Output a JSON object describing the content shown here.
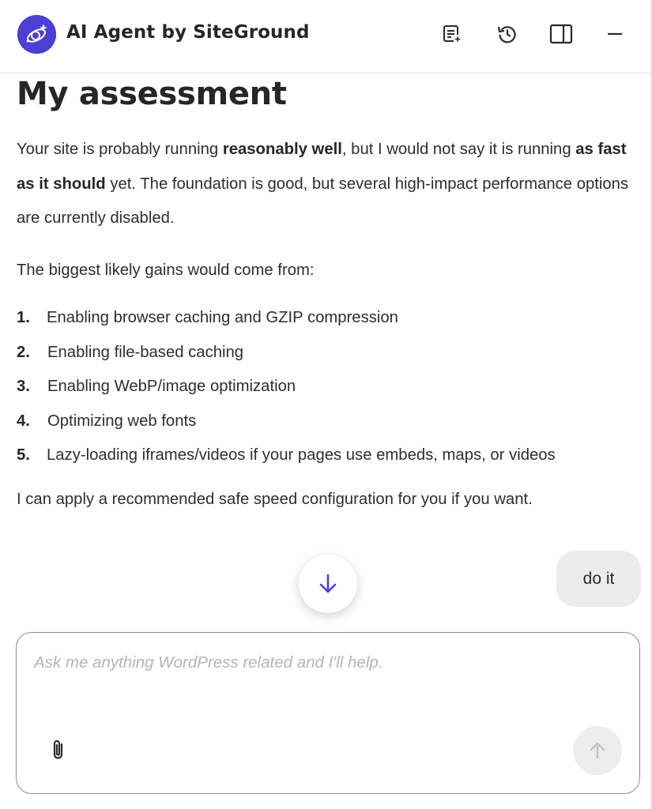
{
  "header": {
    "title": "AI Agent by SiteGround",
    "logo_icon": "siteground-ai-logo-icon",
    "actions": [
      {
        "icon": "new-chat-icon"
      },
      {
        "icon": "history-icon"
      },
      {
        "icon": "panel-layout-icon"
      },
      {
        "icon": "minimize-icon"
      }
    ]
  },
  "message": {
    "heading": "My assessment",
    "p1": {
      "t1": "Your site is probably running ",
      "b1": "reasonably well",
      "t2": ", but I would not say it is running ",
      "b2": "as fast as it should",
      "t3": " yet. The foundation is good, but several high-impact performance options are currently disabled."
    },
    "p2": "The biggest likely gains would come from:",
    "list": [
      {
        "num": "1.",
        "text": "Enabling browser caching and GZIP compression"
      },
      {
        "num": "2.",
        "text": "Enabling file-based caching"
      },
      {
        "num": "3.",
        "text": "Enabling WebP/image optimization"
      },
      {
        "num": "4.",
        "text": "Optimizing web fonts"
      },
      {
        "num": "5.",
        "text": "Lazy-loading iframes/videos if your pages use embeds, maps, or videos"
      }
    ],
    "p3": "I can apply a recommended safe speed configuration for you if you want."
  },
  "user_message": "do it",
  "composer": {
    "value": "",
    "placeholder": "Ask me anything WordPress related and I'll help.",
    "attach_icon": "paperclip-icon",
    "send_icon": "arrow-up-icon"
  },
  "scroll_icon": "arrow-down-icon",
  "colors": {
    "brand": "#4b3fd4",
    "text": "#2e2e2e",
    "bubble": "#ececec",
    "send_disabled": "#ededed"
  }
}
